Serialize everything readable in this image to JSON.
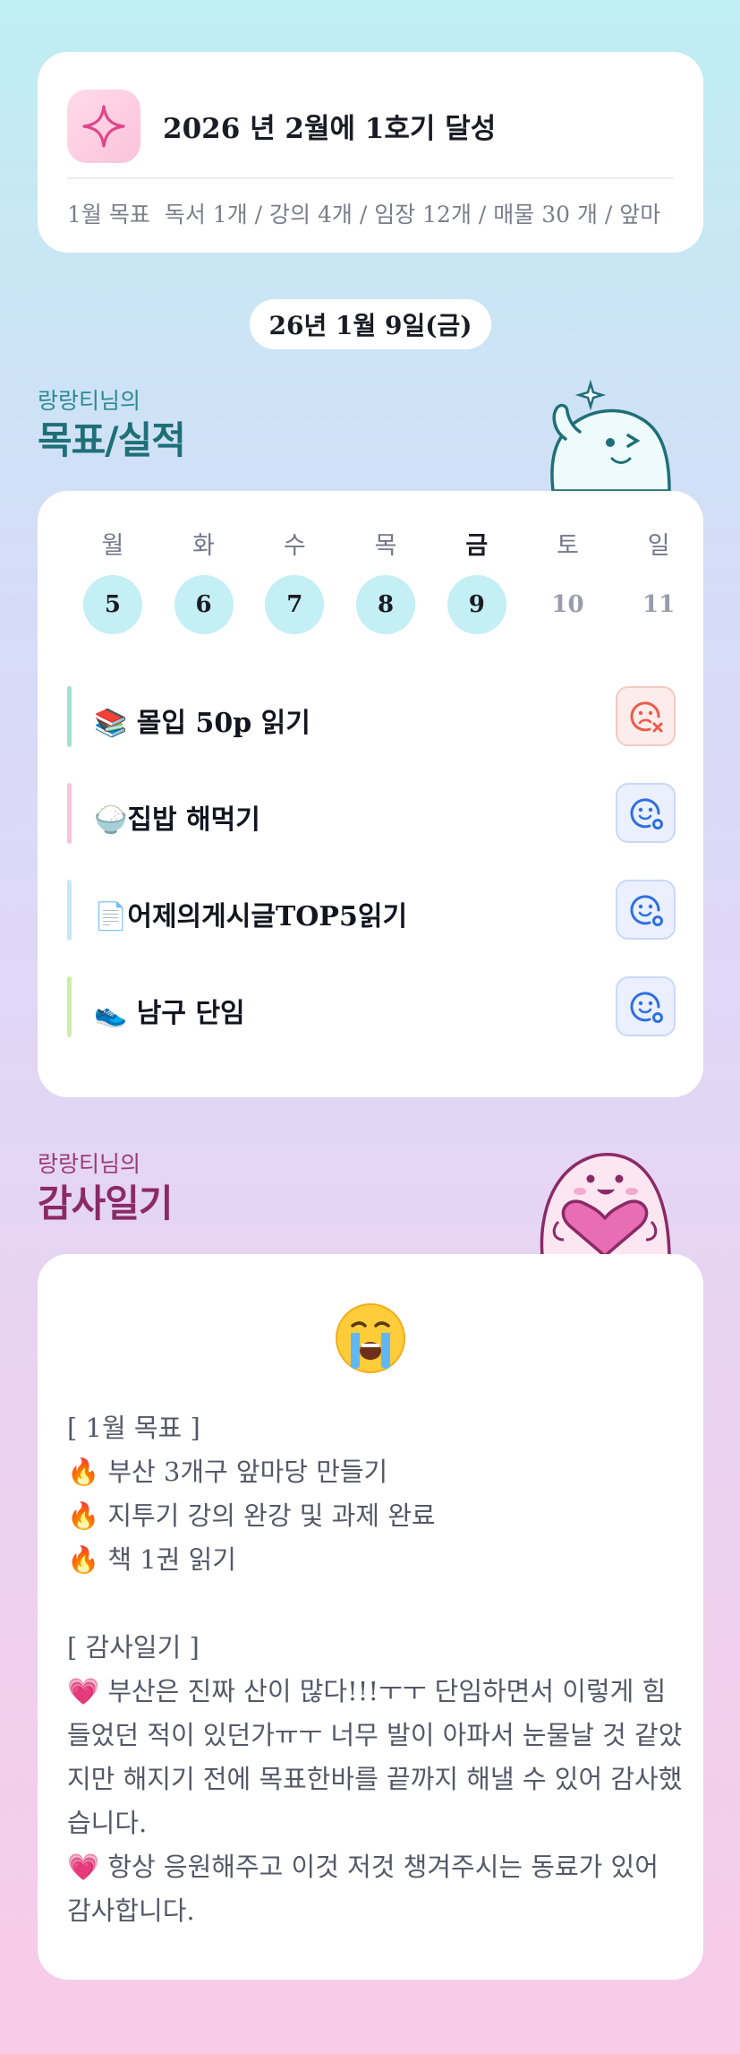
{
  "goal": {
    "title": "2026 년 2월에 1호기 달성",
    "month_label": "1월 목표",
    "month_items": "독서 1개 / 강의 4개 / 임장 12개 / 매물 30 개 / 앞마",
    "icon": "sparkle-icon"
  },
  "date": "26년 1월 9일(금)",
  "section_goals": {
    "owner": "랑랑티님의",
    "title": "목표/실적"
  },
  "week": [
    {
      "day": "월",
      "num": "5",
      "state": "done"
    },
    {
      "day": "화",
      "num": "6",
      "state": "done"
    },
    {
      "day": "수",
      "num": "7",
      "state": "done"
    },
    {
      "day": "목",
      "num": "8",
      "state": "done"
    },
    {
      "day": "금",
      "num": "9",
      "state": "today"
    },
    {
      "day": "토",
      "num": "10",
      "state": "future"
    },
    {
      "day": "일",
      "num": "11",
      "state": "future"
    }
  ],
  "todos": [
    {
      "emoji": "📚",
      "label": " 몰입 50p  읽기",
      "bar_color": "#9fe3d2",
      "status": "fail",
      "icon": "sad-face-x-icon"
    },
    {
      "emoji": "🍚",
      "label": "집밥 해먹기",
      "bar_color": "#f9c4de",
      "status": "done",
      "icon": "smile-face-check-icon"
    },
    {
      "emoji": "📄",
      "label": "어제의게시글TOP5읽기",
      "bar_color": "#c7e8f4",
      "status": "done",
      "icon": "smile-face-check-icon"
    },
    {
      "emoji": "👟",
      "label": " 남구 단임",
      "bar_color": "#cfedaa",
      "status": "done",
      "icon": "smile-face-check-icon"
    }
  ],
  "section_gratitude": {
    "owner": "랑랑티님의",
    "title": "감사일기"
  },
  "gratitude": {
    "emoji": "crying-face-icon",
    "goal_header": "[ 1월 목표 ]",
    "goals": [
      "🔥 부산 3개구 앞마당 만들기",
      "🔥 지투기 강의 완강 및 과제 완료",
      "🔥 책 1권 읽기"
    ],
    "diary_header": "[ 감사일기 ]",
    "entries": [
      "💗 부산은 진짜 산이 많다!!!ㅜㅜ 단임하면서 이렇게 힘들었던 적이 있던가ㅠㅜ 너무 발이 아파서 눈물날 것 같았지만 해지기 전에 목표한바를 끝까지 해낼 수 있어 감사했습니다.",
      "💗 항상 응원해주고 이것 저것 챙겨주시는 동료가 있어 감사합니다."
    ]
  },
  "colors": {
    "accent_teal": "#1f6f78",
    "accent_plum": "#8a2a66",
    "done_day": "#c3eff5",
    "fail_icon": "#ef5a4a",
    "ok_icon": "#2f6fe0"
  }
}
